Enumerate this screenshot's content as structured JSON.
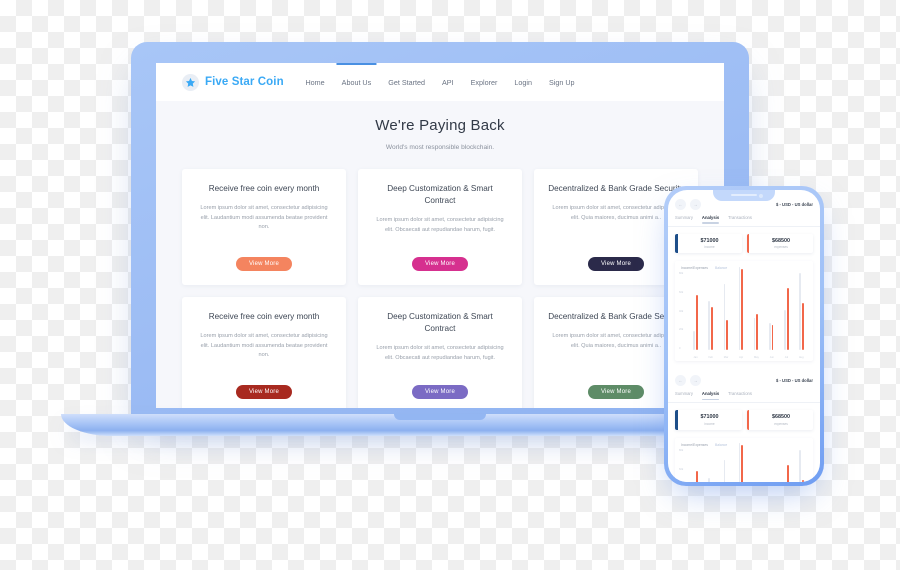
{
  "site": {
    "brand": {
      "name": "Five Star Coin",
      "icon": "star-icon",
      "color": "#3aa9f5"
    },
    "nav": [
      {
        "label": "Home",
        "active": false
      },
      {
        "label": "About Us",
        "active": true
      },
      {
        "label": "Get Started",
        "active": false
      },
      {
        "label": "API",
        "active": false
      },
      {
        "label": "Explorer",
        "active": false
      },
      {
        "label": "Login",
        "active": false
      },
      {
        "label": "Sign Up",
        "active": false
      }
    ],
    "hero": {
      "title": "We're Paying Back",
      "subtitle": "World's most responsible blockchain."
    },
    "cards": [
      {
        "title": "Receive free coin every month",
        "text": "Lorem ipsum dolor sit amet, consectetur adipisicing elit. Laudantium modi assumenda beatae provident non.",
        "button": "View More",
        "button_color": "#f4845f"
      },
      {
        "title": "Deep Customization & Smart Contract",
        "text": "Lorem ipsum dolor sit amet, consectetur adipisicing elit. Obcaecati aut repudiandae harum, fugit.",
        "button": "View More",
        "button_color": "#d6308f"
      },
      {
        "title": "Decentralized & Bank Grade Security",
        "text": "Lorem ipsum dolor sit amet, consectetur adipisicing elit. Quia maiores, ducimus animi a..",
        "button": "View More",
        "button_color": "#2b2a4a"
      },
      {
        "title": "Receive free coin every month",
        "text": "Lorem ipsum dolor sit amet, consectetur adipisicing elit. Laudantium modi assumenda beatae provident non.",
        "button": "View More",
        "button_color": "#a82a20"
      },
      {
        "title": "Deep Customization & Smart Contract",
        "text": "Lorem ipsum dolor sit amet, consectetur adipisicing elit. Obcaecati aut repudiandae harum, fugit.",
        "button": "View More",
        "button_color": "#7b6bc4"
      },
      {
        "title": "Decentralized & Bank Grade Security",
        "text": "Lorem ipsum dolor sit amet, consectetur adipisicing elit. Quia maiores, ducimus animi a..",
        "button": "View More",
        "button_color": "#5e8c67"
      }
    ]
  },
  "phone": {
    "back_icon": "arrow-left-icon",
    "forward_icon": "arrow-right-icon",
    "currency": "$ - USD - US dollar",
    "tabs": [
      {
        "label": "Summary",
        "active": false
      },
      {
        "label": "Analysis",
        "active": true
      },
      {
        "label": "Transactions",
        "active": false
      }
    ],
    "stats": [
      {
        "value": "$71000",
        "label": "income",
        "accent": "#1d4e89"
      },
      {
        "value": "$68500",
        "label": "expenses",
        "accent": "#f2674a"
      }
    ],
    "legend": [
      {
        "label": "Income/Expenses",
        "color": "#9aa2af"
      },
      {
        "label": "Balance",
        "color": "#b9c6dd"
      }
    ],
    "chart_data": {
      "type": "bar",
      "title": "",
      "xlabel": "",
      "ylabel": "",
      "categories": [
        "Jan",
        "Feb",
        "Mar",
        "Apr",
        "May",
        "Jun",
        "Jul",
        "Aug"
      ],
      "ytick_labels": [
        "80k",
        "60k",
        "40k",
        "20k",
        "0"
      ],
      "ylim": [
        0,
        80000
      ],
      "grid": false,
      "legend_position": "top-left",
      "series": [
        {
          "name": "Balance",
          "color": "#e6eaf1",
          "values": [
            18000,
            46000,
            62000,
            78000,
            30000,
            26000,
            38000,
            72000
          ]
        },
        {
          "name": "Income/Expenses",
          "color": "#f2674a",
          "values": [
            52000,
            40000,
            28000,
            76000,
            34000,
            24000,
            58000,
            44000
          ]
        }
      ]
    }
  }
}
